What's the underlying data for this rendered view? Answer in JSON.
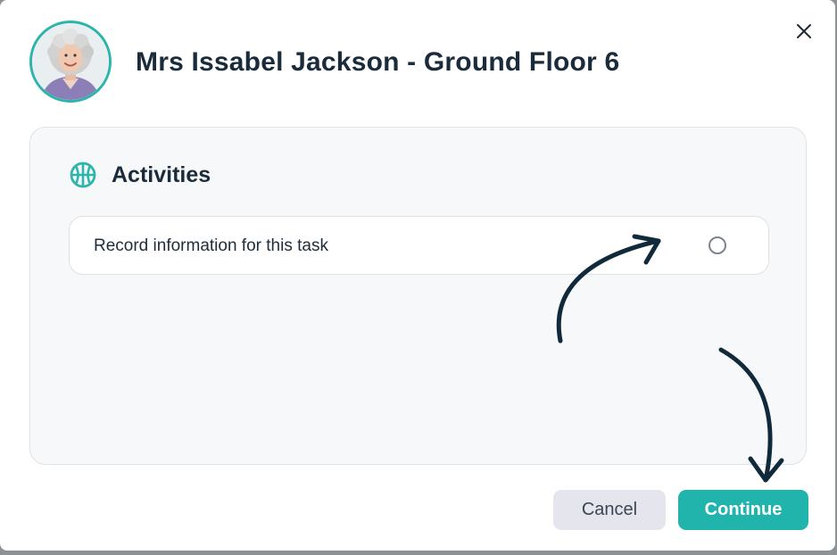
{
  "modal": {
    "title": "Mrs Issabel Jackson - Ground Floor 6"
  },
  "section": {
    "title": "Activities",
    "icon": "basketball-icon"
  },
  "task": {
    "label": "Record information for this task",
    "selected": false
  },
  "buttons": {
    "cancel": "Cancel",
    "continue": "Continue"
  },
  "colors": {
    "accent": "#20b4ad",
    "title_text": "#1a2b3b",
    "panel_bg": "#f7f8f9",
    "annotation_arrows": "#102a3c"
  }
}
